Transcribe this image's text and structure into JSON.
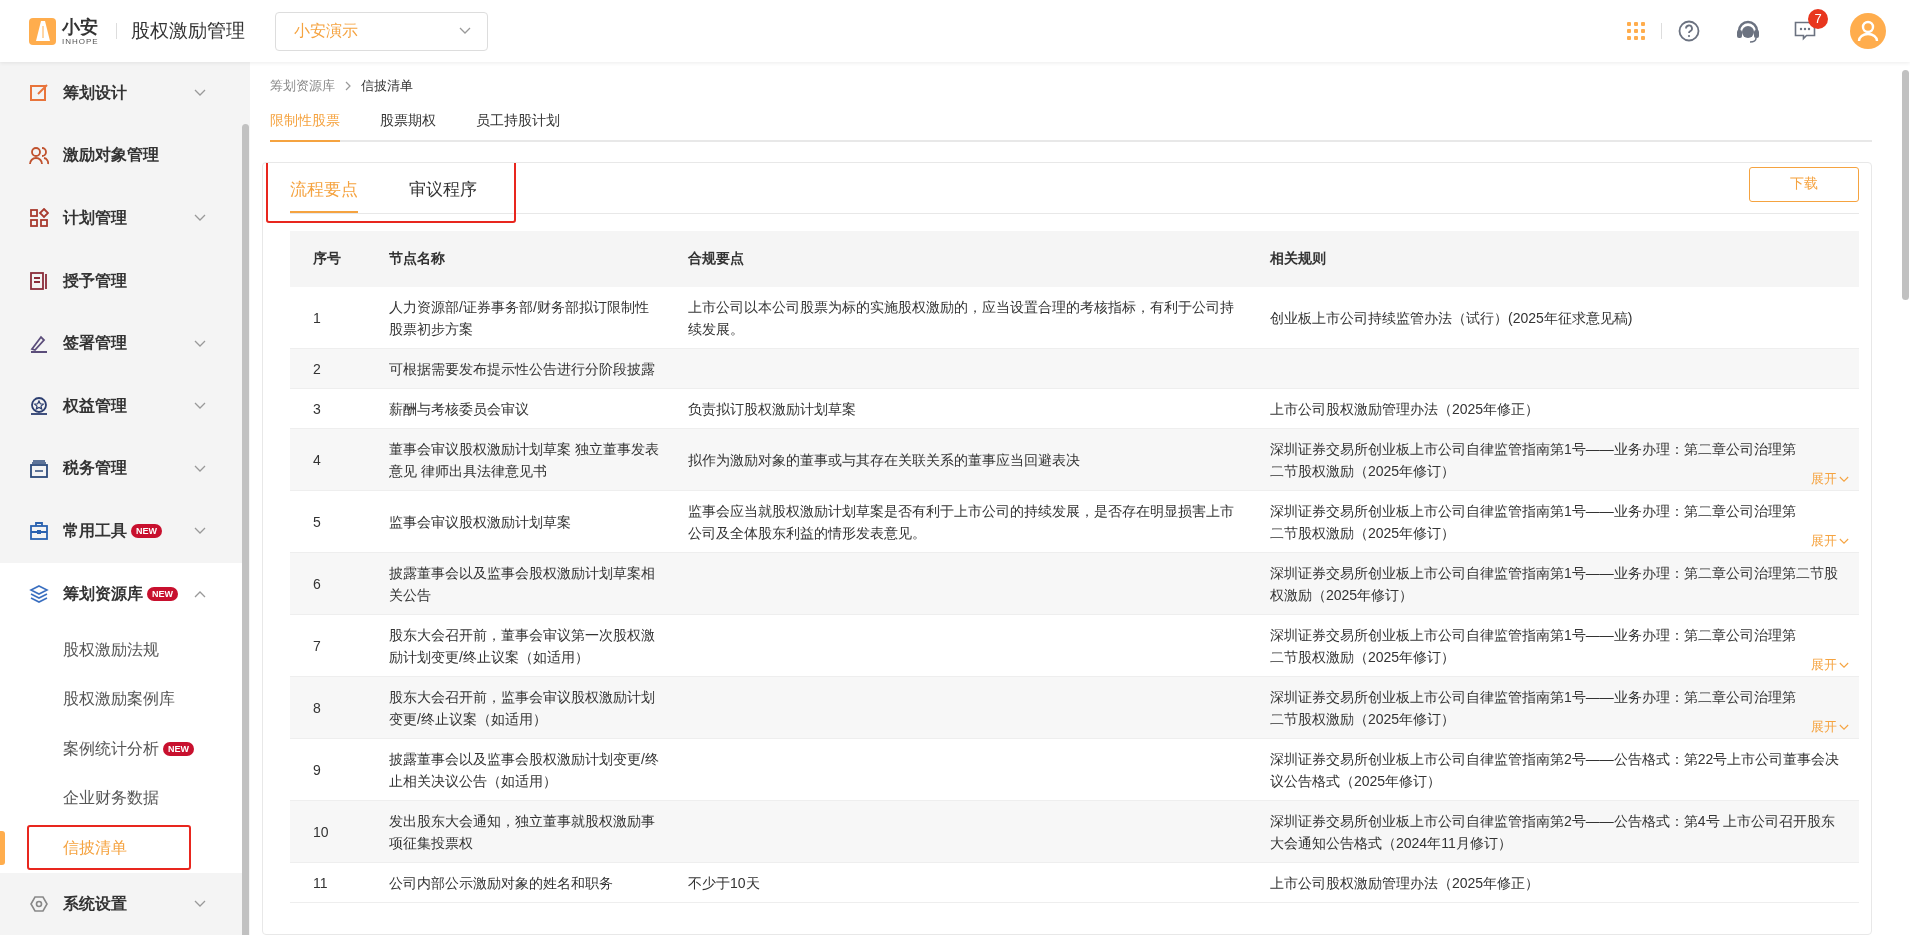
{
  "header": {
    "logo_text": "小安",
    "logo_subtext": "INHOPE",
    "app_title": "股权激励管理",
    "company_select": {
      "value": "小安演示"
    },
    "message_badge": "7"
  },
  "sidebar": {
    "items": [
      {
        "label": "筹划设计",
        "kind": "group",
        "expanded": false
      },
      {
        "label": "激励对象管理",
        "kind": "link"
      },
      {
        "label": "计划管理",
        "kind": "group",
        "expanded": false
      },
      {
        "label": "授予管理",
        "kind": "link"
      },
      {
        "label": "签署管理",
        "kind": "group",
        "expanded": false
      },
      {
        "label": "权益管理",
        "kind": "group",
        "expanded": false
      },
      {
        "label": "税务管理",
        "kind": "group",
        "expanded": false
      },
      {
        "label": "常用工具",
        "kind": "group",
        "expanded": false,
        "badge": "NEW"
      },
      {
        "label": "筹划资源库",
        "kind": "group",
        "expanded": true,
        "badge": "NEW",
        "children": [
          {
            "label": "股权激励法规",
            "selected": false
          },
          {
            "label": "股权激励案例库",
            "selected": false
          },
          {
            "label": "案例统计分析",
            "selected": false,
            "badge": "NEW"
          },
          {
            "label": "企业财务数据",
            "selected": false
          },
          {
            "label": "信披清单",
            "selected": true
          }
        ]
      },
      {
        "label": "系统设置",
        "kind": "group",
        "expanded": false
      }
    ]
  },
  "breadcrumb": [
    "筹划资源库",
    "信披清单"
  ],
  "tabs": [
    {
      "label": "限制性股票",
      "selected": true
    },
    {
      "label": "股票期权",
      "selected": false
    },
    {
      "label": "员工持股计划",
      "selected": false
    }
  ],
  "panel": {
    "tabs": [
      {
        "label": "流程要点",
        "selected": true
      },
      {
        "label": "审议程序",
        "selected": false
      }
    ],
    "download_button": "下载",
    "table": {
      "columns": [
        "序号",
        "节点名称",
        "合规要点",
        "相关规则"
      ],
      "rows": [
        {
          "cells": [
            "1",
            "人力资源部/证券事务部/财务部拟订限制性股票初步方案",
            "上市公司以本公司股票为标的实施股权激励的，应当设置合理的考核指标，有利于公司持续发展。",
            "创业板上市公司持续监管办法（试行）(2025年征求意见稿)"
          ]
        },
        {
          "cells": [
            "2",
            "可根据需要发布提示性公告进行分阶段披露",
            "",
            ""
          ]
        },
        {
          "cells": [
            "3",
            "薪酬与考核委员会审议",
            "负责拟订股权激励计划草案",
            "上市公司股权激励管理办法（2025年修正）"
          ]
        },
        {
          "cells": [
            "4",
            "董事会审议股权激励计划草案 独立董事发表意见 律师出具法律意见书",
            "拟作为激励对象的董事或与其存在关联关系的董事应当回避表决",
            "深圳证券交易所创业板上市公司自律监管指南第1号——业务办理：第二章公司治理第二节股权激励（2025年修订）"
          ],
          "expand_link": "展开"
        },
        {
          "cells": [
            "5",
            "监事会审议股权激励计划草案",
            "监事会应当就股权激励计划草案是否有利于上市公司的持续发展，是否存在明显损害上市公司及全体股东利益的情形发表意见。",
            "深圳证券交易所创业板上市公司自律监管指南第1号——业务办理：第二章公司治理第二节股权激励（2025年修订）"
          ],
          "expand_link": "展开"
        },
        {
          "cells": [
            "6",
            "披露董事会以及监事会股权激励计划草案相关公告",
            "",
            "深圳证券交易所创业板上市公司自律监管指南第1号——业务办理：第二章公司治理第二节股权激励（2025年修订）"
          ]
        },
        {
          "cells": [
            "7",
            "股东大会召开前，董事会审议第一次股权激励计划变更/终止议案（如适用）",
            "",
            "深圳证券交易所创业板上市公司自律监管指南第1号——业务办理：第二章公司治理第二节股权激励（2025年修订）"
          ],
          "expand_link": "展开"
        },
        {
          "cells": [
            "8",
            "股东大会召开前，监事会审议股权激励计划变更/终止议案（如适用）",
            "",
            "深圳证券交易所创业板上市公司自律监管指南第1号——业务办理：第二章公司治理第二节股权激励（2025年修订）"
          ],
          "expand_link": "展开"
        },
        {
          "cells": [
            "9",
            "披露董事会以及监事会股权激励计划变更/终止相关决议公告（如适用）",
            "",
            "深圳证券交易所创业板上市公司自律监管指南第2号——公告格式：第22号上市公司董事会决议公告格式（2025年修订）"
          ]
        },
        {
          "cells": [
            "10",
            "发出股东大会通知，独立董事就股权激励事项征集投票权",
            "",
            "深圳证券交易所创业板上市公司自律监管指南第2号——公告格式：第4号 上市公司召开股东大会通知公告格式（2024年11月修订）"
          ]
        },
        {
          "cells": [
            "11",
            "公司内部公示激励对象的姓名和职务",
            "不少于10天",
            "上市公司股权激励管理办法（2025年修正）"
          ]
        }
      ]
    }
  }
}
